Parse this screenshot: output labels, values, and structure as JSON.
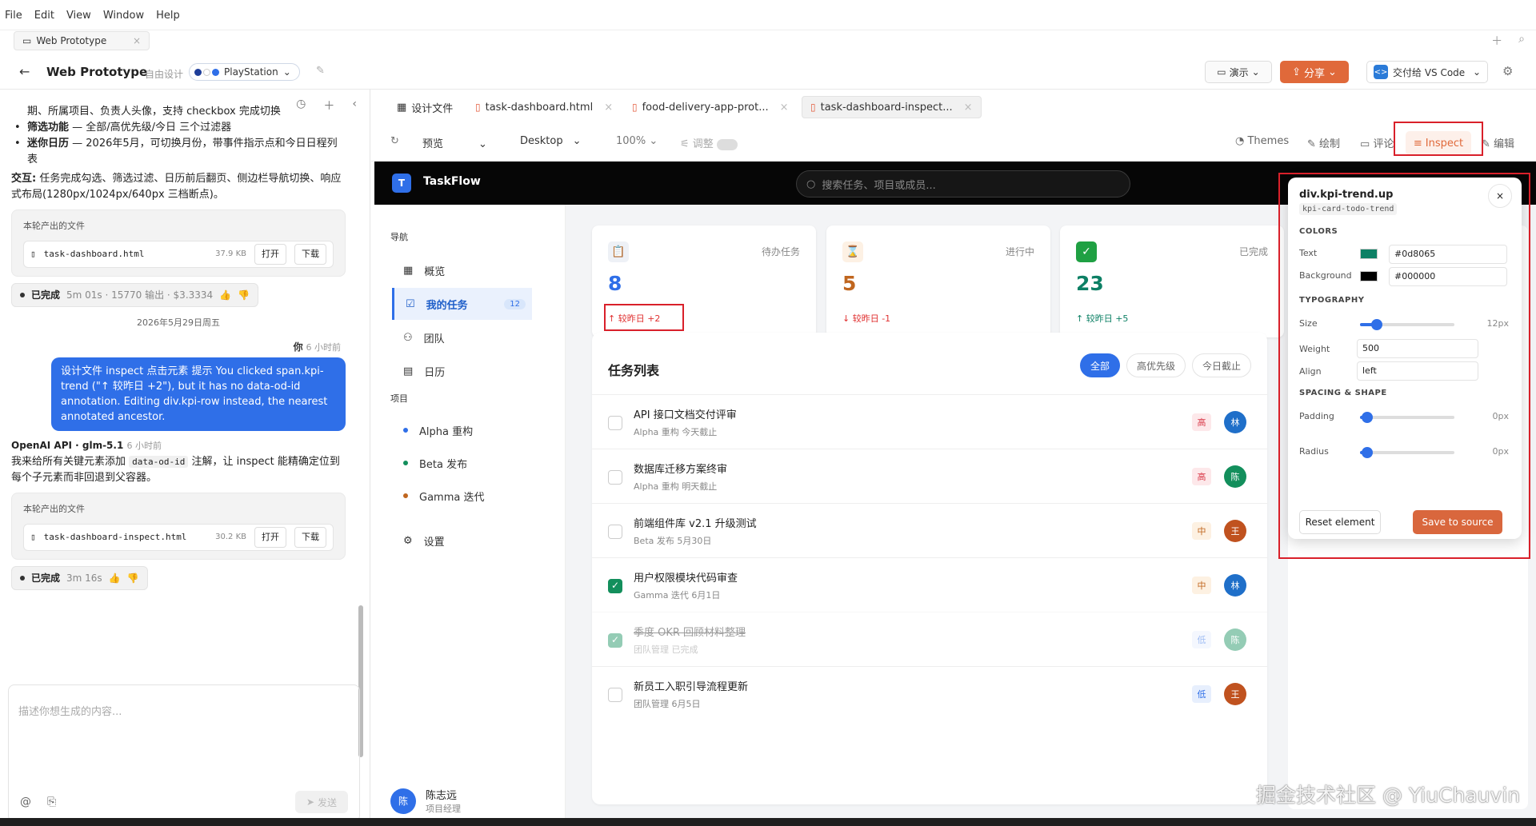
{
  "menubar": {
    "items": [
      "File",
      "Edit",
      "View",
      "Window",
      "Help"
    ]
  },
  "window_tab": {
    "label": "Web Prototype"
  },
  "header": {
    "title": "Web Prototype",
    "mode": "自由设计",
    "theme": "PlayStation",
    "theme_dots": [
      "#1f3e99",
      "#ffffff",
      "#2f6fe8"
    ]
  },
  "actions": {
    "demo": "演示",
    "share": "分享",
    "vscode": "交付给 VS Code"
  },
  "chat": {
    "intro_line": "期、所属项目、负责人头像，支持 checkbox 完成切换",
    "bullets": [
      {
        "bold": "筛选功能",
        "text": " — 全部/高优先级/今日 三个过滤器"
      },
      {
        "bold": "迷你日历",
        "text": " — 2026年5月，可切换月份，带事件指示点和今日日程列表"
      }
    ],
    "interaction_bold": "交互:",
    "interaction_text": " 任务完成勾选、筛选过滤、日历前后翻页、侧边栏导航切换、响应式布局(1280px/1024px/640px 三档断点)。",
    "file_card_label": "本轮产出的文件",
    "file1": {
      "name": "task-dashboard.html",
      "size": "37.9 KB"
    },
    "open_label": "打开",
    "download_label": "下载",
    "done1": {
      "label": "已完成",
      "meta": "5m 01s · 15770 输出 · $3.3334"
    },
    "date_divider": "2026年5月29日周五",
    "you_label": "你",
    "you_time": "6 小时前",
    "user_message": "设计文件 inspect 点击元素 提示 You clicked span.kpi-trend (\"↑ 较昨日 +2\"), but it has no data-od-id annotation. Editing div.kpi-row instead, the nearest annotated ancestor.",
    "ai_name": "OpenAI API · glm-5.1",
    "ai_time": "6 小时前",
    "ai_text_1": "我来给所有关键元素添加 ",
    "ai_code": "data-od-id",
    "ai_text_2": " 注解，让 inspect 能精确定位到每个子元素而非回退到父容器。",
    "file2": {
      "name": "task-dashboard-inspect.html",
      "size": "30.2 KB"
    },
    "done2": {
      "label": "已完成",
      "meta": "3m 16s"
    },
    "input_placeholder": "描述你想生成的内容...",
    "send_label": "发送"
  },
  "file_tabs": [
    {
      "label": "设计文件"
    },
    {
      "label": "task-dashboard.html"
    },
    {
      "label": "food-delivery-app-prot..."
    },
    {
      "label": "task-dashboard-inspect..."
    }
  ],
  "toolbar": {
    "preview": "预览",
    "device": "Desktop",
    "zoom": "100%",
    "adjust": "调整",
    "themes": "Themes",
    "draw": "绘制",
    "comment": "评论",
    "inspect": "Inspect",
    "edit": "编辑"
  },
  "app": {
    "logo_letter": "T",
    "brand": "TaskFlow",
    "search_placeholder": "搜索任务、项目或成员...",
    "nav_label": "导航",
    "nav": [
      {
        "label": "概览",
        "icon": "grid-icon"
      },
      {
        "label": "我的任务",
        "icon": "checkbox-icon",
        "badge": "12"
      },
      {
        "label": "团队",
        "icon": "users-icon"
      },
      {
        "label": "日历",
        "icon": "calendar-icon"
      }
    ],
    "projects_label": "项目",
    "projects": [
      {
        "label": "Alpha 重构",
        "color": "#2f6fe8"
      },
      {
        "label": "Beta 发布",
        "color": "#138f5c"
      },
      {
        "label": "Gamma 迭代",
        "color": "#c0661f"
      }
    ],
    "settings_label": "设置",
    "user": {
      "initial": "陈",
      "name": "陈志远",
      "role": "项目经理"
    },
    "kpis": [
      {
        "label": "待办任务",
        "value": "8",
        "trend": "↑ 较昨日 +2",
        "color": "#2f6fe8",
        "trend_color": "#e03030"
      },
      {
        "label": "进行中",
        "value": "5",
        "trend": "↓ 较昨日 -1",
        "color": "#c0661f",
        "trend_color": "#e03030"
      },
      {
        "label": "已完成",
        "value": "23",
        "trend": "↑ 较昨日 +5",
        "color": "#0d8065",
        "trend_color": "#0d8065"
      }
    ],
    "tasks_title": "任务列表",
    "filters": [
      "全部",
      "高优先级",
      "今日截止"
    ],
    "tasks": [
      {
        "name": "API 接口文档交付评审",
        "meta": "Alpha 重构   今天截止",
        "priority": "高",
        "assignee": "林",
        "done": false,
        "faded": false
      },
      {
        "name": "数据库迁移方案终审",
        "meta": "Alpha 重构   明天截止",
        "priority": "高",
        "assignee": "陈",
        "done": false,
        "faded": false
      },
      {
        "name": "前端组件库 v2.1 升级测试",
        "meta": "Beta 发布   5月30日",
        "priority": "中",
        "assignee": "王",
        "done": false,
        "faded": false
      },
      {
        "name": "用户权限模块代码审查",
        "meta": "Gamma 迭代   6月1日",
        "priority": "中",
        "assignee": "林",
        "done": true,
        "faded": false
      },
      {
        "name": "季度 OKR 回顾材料整理",
        "meta": "团队管理   已完成",
        "priority": "低",
        "assignee": "陈",
        "done": true,
        "faded": true
      },
      {
        "name": "新员工入职引导流程更新",
        "meta": "团队管理   6月5日",
        "priority": "低",
        "assignee": "王",
        "done": false,
        "faded": false
      }
    ]
  },
  "inspector": {
    "selector": "div.kpi-trend.up",
    "class_name": "kpi-card-todo-trend",
    "colors_label": "COLORS",
    "text_label": "Text",
    "text_color": "#0d8065",
    "bg_label": "Background",
    "bg_color": "#000000",
    "typography_label": "TYPOGRAPHY",
    "size_label": "Size",
    "size_value": "12px",
    "weight_label": "Weight",
    "weight_value": "500",
    "align_label": "Align",
    "align_value": "left",
    "spacing_label": "SPACING & SHAPE",
    "padding_label": "Padding",
    "padding_value": "0px",
    "radius_label": "Radius",
    "radius_value": "0px",
    "reset": "Reset element",
    "save": "Save to source"
  },
  "watermark": "掘金技术社区 @ YiuChauvin"
}
